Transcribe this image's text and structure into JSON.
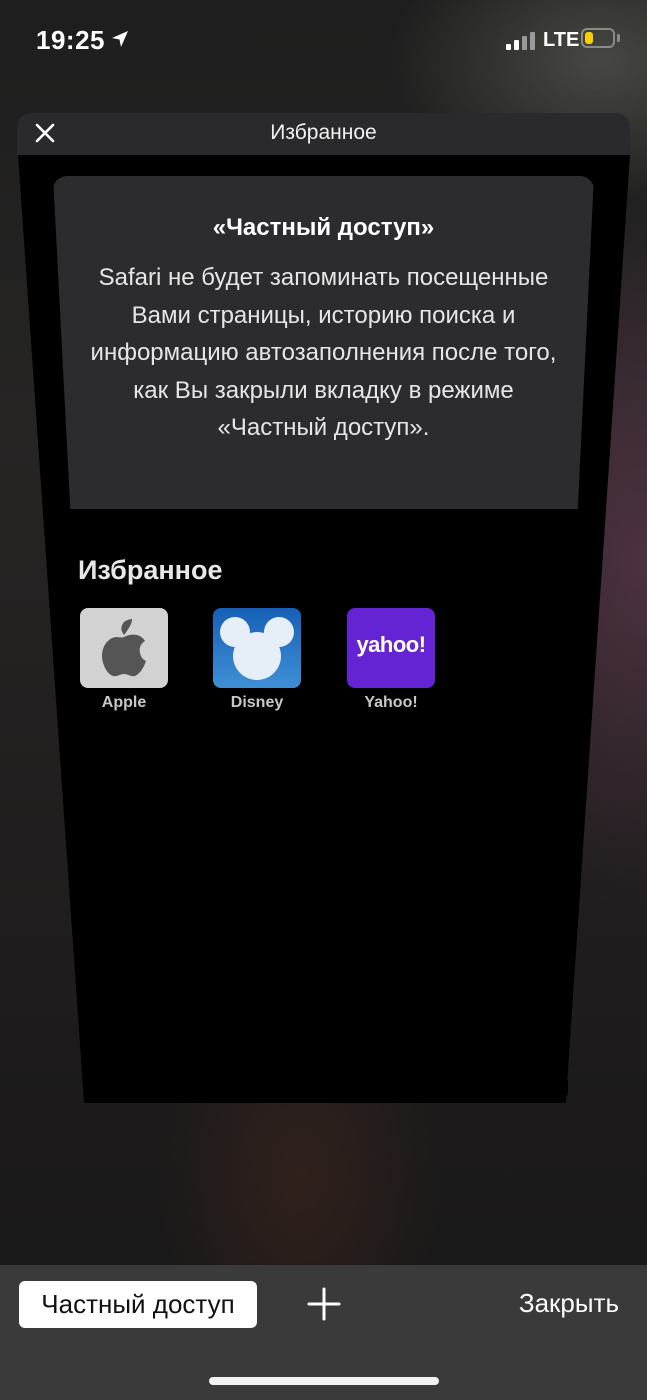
{
  "status_bar": {
    "time": "19:25",
    "network": "LTE",
    "battery_level": 0.3,
    "battery_color": "#f5d000",
    "location_icon": "location-arrow-icon"
  },
  "tab": {
    "title": "Избранное",
    "close_icon": "close-icon"
  },
  "private_notice": {
    "title": "«Частный доступ»",
    "text": "Safari не будет запоминать посещенные Вами страницы, историю поиска и информацию автозаполнения после того, как Вы закрыли вкладку в режиме «Частный доступ»."
  },
  "favorites": {
    "heading": "Избранное",
    "items": [
      {
        "label": "Apple",
        "icon": "apple-logo-icon",
        "color": "#d2d2d2"
      },
      {
        "label": "Disney",
        "icon": "mickey-mouse-icon",
        "color": "#2b77c9"
      },
      {
        "label": "Yahoo!",
        "icon": "yahoo-logo-icon",
        "color": "#6524d4",
        "logo_text": "yahoo!"
      }
    ]
  },
  "toolbar": {
    "private_label": "Частный доступ",
    "add_icon": "plus-icon",
    "close_label": "Закрыть"
  }
}
